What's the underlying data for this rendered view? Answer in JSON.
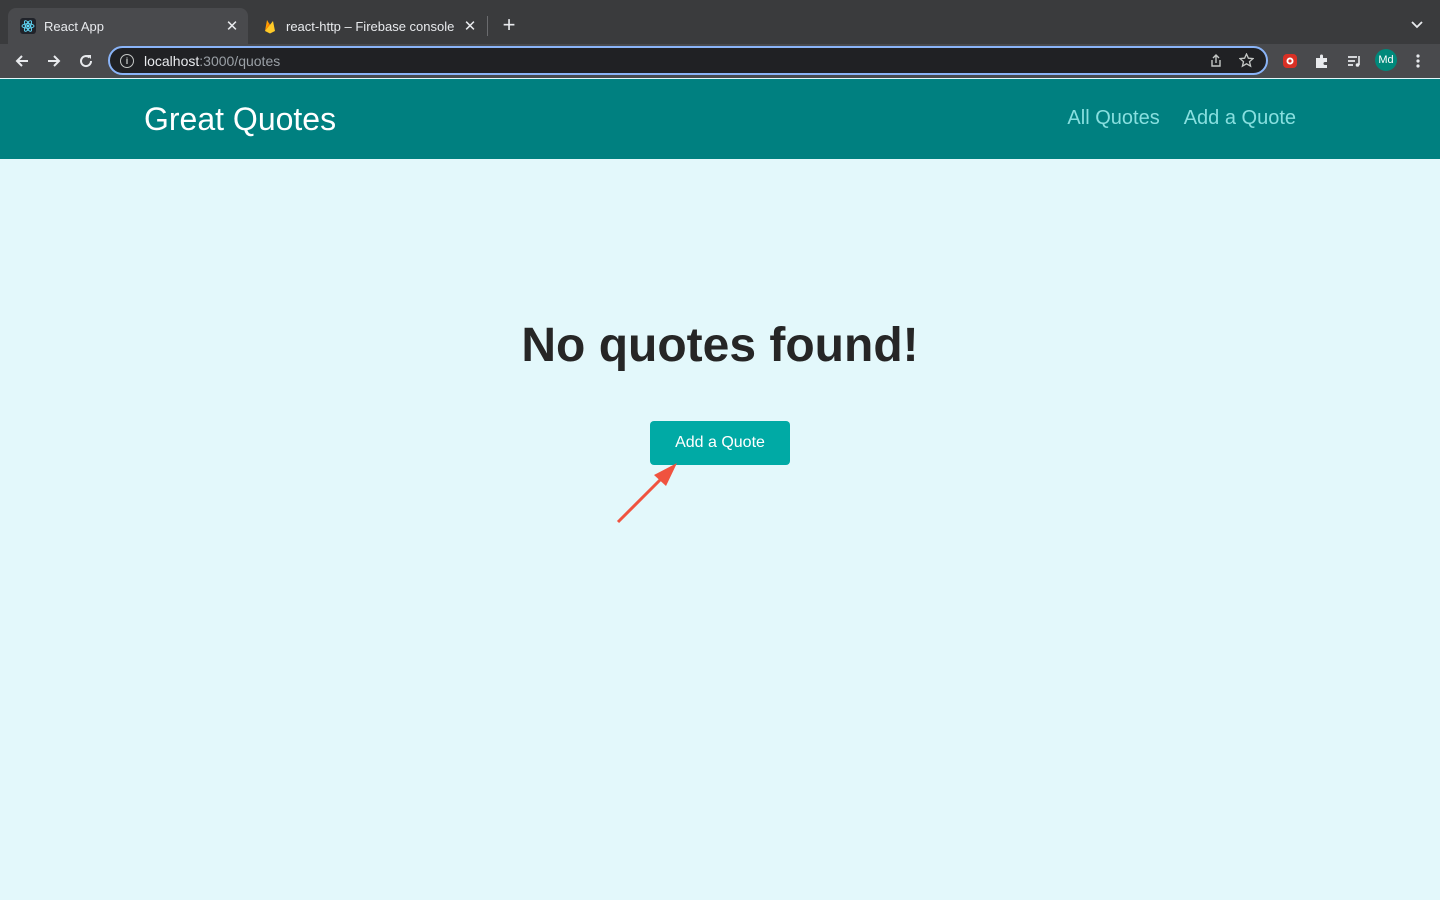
{
  "browser": {
    "tabs": [
      {
        "title": "React App",
        "icon": "react-icon",
        "active": true
      },
      {
        "title": "react-http – Firebase console",
        "icon": "firebase-icon",
        "active": false
      }
    ],
    "url": {
      "host": "localhost",
      "path": ":3000/quotes"
    },
    "profile_initials": "Md",
    "accent_color": "#8ab4f8"
  },
  "app": {
    "logo": "Great Quotes",
    "nav": {
      "all_quotes": "All Quotes",
      "add_quote": "Add a Quote"
    },
    "header_color": "#008080"
  },
  "main": {
    "heading": "No quotes found!",
    "cta_label": "Add a Quote",
    "cta_color": "#00aaa5",
    "annotation": "red-arrow-pointing-to-button"
  }
}
